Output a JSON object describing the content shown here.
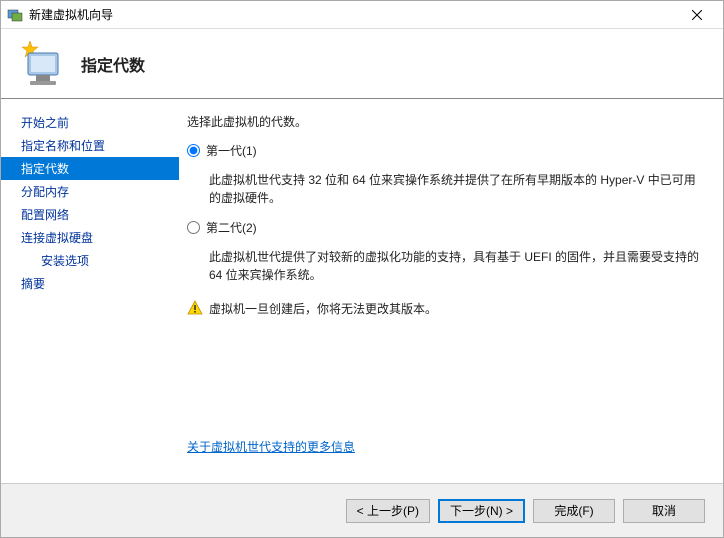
{
  "titlebar": {
    "title": "新建虚拟机向导"
  },
  "header": {
    "title": "指定代数"
  },
  "sidebar": {
    "items": [
      {
        "label": "开始之前"
      },
      {
        "label": "指定名称和位置"
      },
      {
        "label": "指定代数"
      },
      {
        "label": "分配内存"
      },
      {
        "label": "配置网络"
      },
      {
        "label": "连接虚拟硬盘"
      },
      {
        "label": "安装选项",
        "sub": true
      },
      {
        "label": "摘要"
      }
    ]
  },
  "main": {
    "prompt": "选择此虚拟机的代数。",
    "gen1": {
      "label": "第一代(1)",
      "desc": "此虚拟机世代支持 32 位和 64 位来宾操作系统并提供了在所有早期版本的 Hyper-V 中已可用的虚拟硬件。"
    },
    "gen2": {
      "label": "第二代(2)",
      "desc": "此虚拟机世代提供了对较新的虚拟化功能的支持，具有基于 UEFI 的固件，并且需要受支持的 64 位来宾操作系统。"
    },
    "warning": "虚拟机一旦创建后，你将无法更改其版本。",
    "link": "关于虚拟机世代支持的更多信息"
  },
  "footer": {
    "back": "< 上一步(P)",
    "next": "下一步(N) >",
    "finish": "完成(F)",
    "cancel": "取消"
  }
}
